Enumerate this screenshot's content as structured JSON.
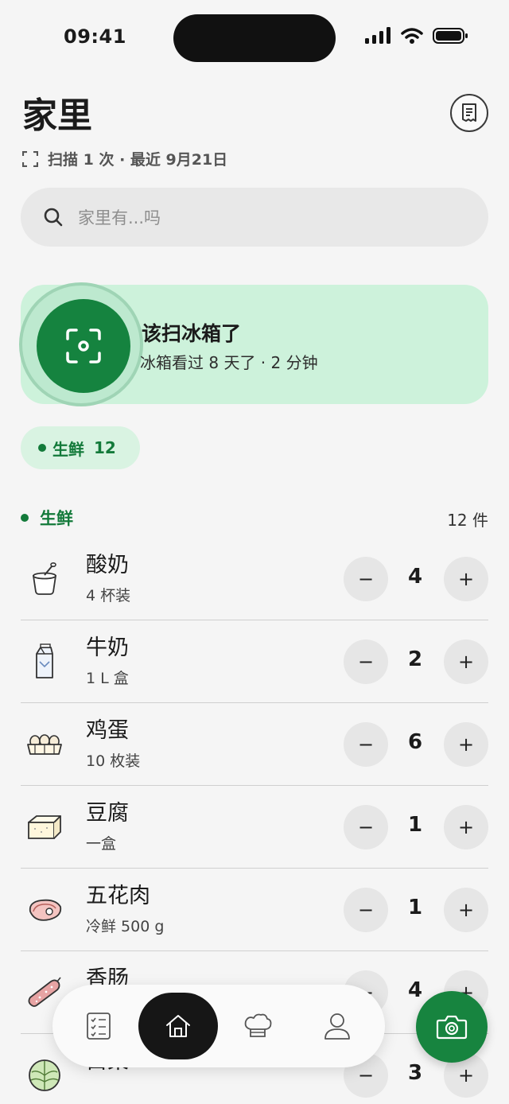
{
  "status_bar": {
    "time": "09:41"
  },
  "header": {
    "title": "家里",
    "scan_info": "扫描 1 次 · 最近 9月21日"
  },
  "search": {
    "placeholder": "家里有...吗"
  },
  "scan_card": {
    "title": "该扫冰箱了",
    "subtitle": "冰箱看过 8 天了 · 2 分钟"
  },
  "filter_chip": {
    "label": "生鲜",
    "count": "12"
  },
  "section": {
    "label": "生鲜",
    "count": "12 件"
  },
  "items": [
    {
      "name": "酸奶",
      "desc": "4 杯装",
      "qty": "4",
      "icon": "yogurt-icon"
    },
    {
      "name": "牛奶",
      "desc": "1 L 盒",
      "qty": "2",
      "icon": "milk-carton-icon"
    },
    {
      "name": "鸡蛋",
      "desc": "10 枚装",
      "qty": "6",
      "icon": "egg-carton-icon"
    },
    {
      "name": "豆腐",
      "desc": "一盒",
      "qty": "1",
      "icon": "tofu-icon"
    },
    {
      "name": "五花肉",
      "desc": "冷鲜 500 g",
      "qty": "1",
      "icon": "meat-icon"
    },
    {
      "name": "香肠",
      "desc": "",
      "qty": "4",
      "icon": "sausage-icon"
    },
    {
      "name": "白菜",
      "desc": "",
      "qty": "3",
      "icon": "cabbage-icon"
    }
  ],
  "controls": {
    "minus": "−",
    "plus": "+"
  },
  "tabbar": {
    "tabs": [
      "checklist-icon",
      "home-icon",
      "chef-hat-icon",
      "person-icon"
    ],
    "active": "home-icon"
  },
  "fab": {
    "icon": "camera-icon"
  },
  "colors": {
    "accent": "#17843f",
    "card_bg": "#cdf2db",
    "chip_bg": "#d9f3e2",
    "background": "#f5f5f5"
  }
}
